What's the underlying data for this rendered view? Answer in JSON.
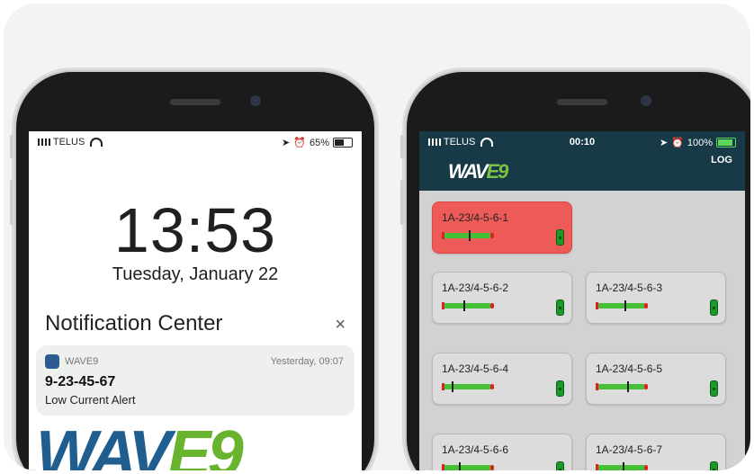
{
  "left_phone": {
    "status": {
      "carrier": "TELUS",
      "battery": "65%",
      "battery_level": 0.65
    },
    "lock_time": "13:53",
    "lock_date": "Tuesday, January 22",
    "notification_center": {
      "title": "Notification Center",
      "close_glyph": "×",
      "notification": {
        "app": "WAVE9",
        "when": "Yesterday, 09:07",
        "title": "9-23-45-67",
        "body": "Low Current Alert"
      }
    },
    "brand_logo": "WAVE9"
  },
  "right_phone": {
    "status": {
      "carrier": "TELUS",
      "time": "00:10",
      "battery": "100%",
      "battery_level": 1.0
    },
    "app": {
      "logo": "WAVE9",
      "log_label": "LOG",
      "tiles": [
        {
          "name": "1A-23/4-5-6-1",
          "state": "alarm",
          "level": 0.55
        },
        {
          "name": "1A-23/4-5-6-2",
          "state": "normal",
          "level": 0.45
        },
        {
          "name": "1A-23/4-5-6-3",
          "state": "normal",
          "level": 0.6
        },
        {
          "name": "1A-23/4-5-6-4",
          "state": "normal",
          "level": 0.2
        },
        {
          "name": "1A-23/4-5-6-5",
          "state": "normal",
          "level": 0.65
        },
        {
          "name": "1A-23/4-5-6-6",
          "state": "normal",
          "level": 0.35
        },
        {
          "name": "1A-23/4-5-6-7",
          "state": "normal",
          "level": 0.55
        }
      ]
    }
  },
  "colors": {
    "header": "#173a46",
    "alarm": "#ec5b57",
    "gauge": "#46c137",
    "brand_blue": "#1f5e8f",
    "brand_green": "#69b42e"
  }
}
